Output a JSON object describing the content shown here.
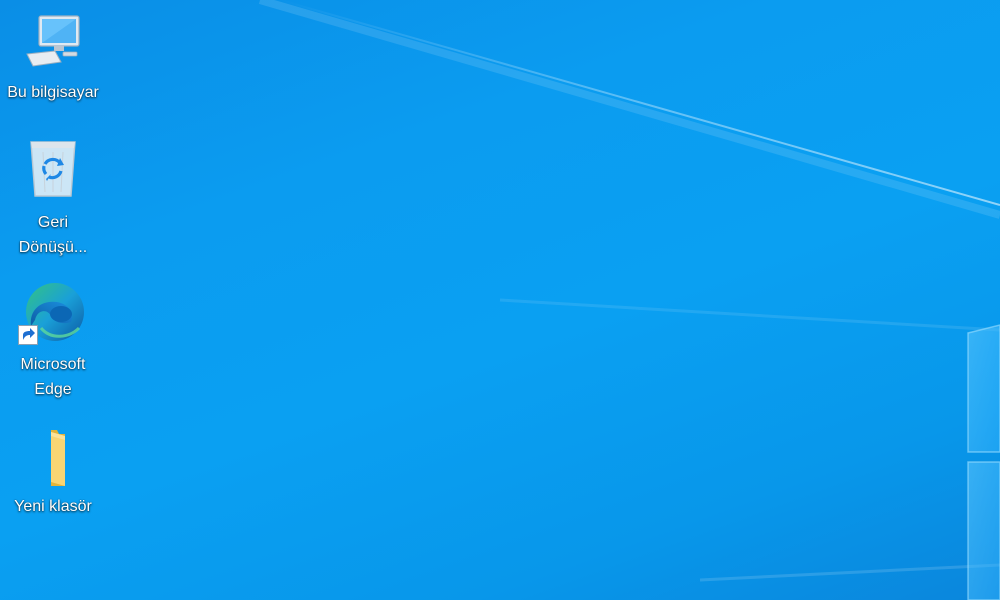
{
  "desktop": {
    "background_color": "#0a9af0",
    "icons": [
      {
        "name": "this-pc",
        "icon": "computer-icon",
        "lines": [
          "Bu bilgisayar"
        ]
      },
      {
        "name": "recycle-bin",
        "icon": "recycle-bin-icon",
        "lines": [
          "Geri",
          "Dönüşü..."
        ]
      },
      {
        "name": "microsoft-edge",
        "icon": "edge-icon",
        "lines": [
          "Microsoft",
          "Edge"
        ]
      },
      {
        "name": "new-folder",
        "icon": "folder-icon",
        "lines": [
          "Yeni klasör"
        ]
      }
    ]
  }
}
